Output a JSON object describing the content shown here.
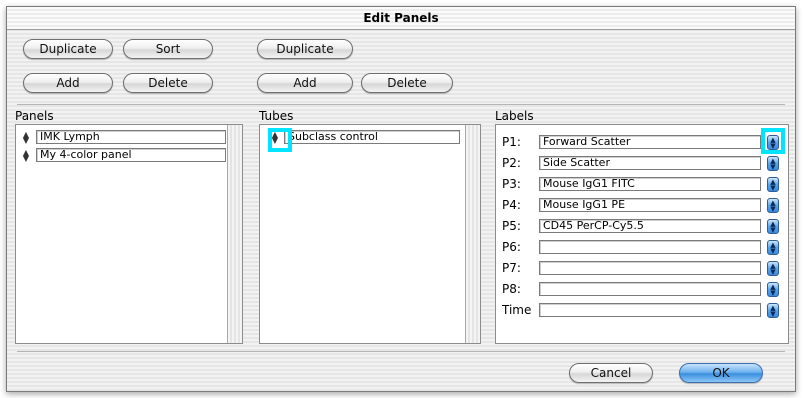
{
  "window": {
    "title": "Edit Panels"
  },
  "panel_buttons": {
    "duplicate": "Duplicate",
    "sort": "Sort",
    "add": "Add",
    "delete": "Delete"
  },
  "tube_buttons": {
    "duplicate": "Duplicate",
    "add": "Add",
    "delete": "Delete"
  },
  "panels": {
    "label": "Panels",
    "items": [
      "IMK Lymph",
      "My 4-color panel"
    ]
  },
  "tubes": {
    "label": "Tubes",
    "items": [
      "Subclass control"
    ]
  },
  "labels": {
    "label": "Labels",
    "rows": [
      {
        "name": "P1:",
        "value": "Forward Scatter"
      },
      {
        "name": "P2:",
        "value": "Side Scatter"
      },
      {
        "name": "P3:",
        "value": "Mouse IgG1 FITC"
      },
      {
        "name": "P4:",
        "value": "Mouse IgG1 PE"
      },
      {
        "name": "P5:",
        "value": "CD45 PerCP-Cy5.5"
      },
      {
        "name": "P6:",
        "value": ""
      },
      {
        "name": "P7:",
        "value": ""
      },
      {
        "name": "P8:",
        "value": ""
      },
      {
        "name": "Time",
        "value": ""
      }
    ]
  },
  "footer": {
    "cancel": "Cancel",
    "ok": "OK"
  },
  "icons": {
    "updown": "updown-arrows-icon",
    "stepper": "stepper-icon"
  },
  "colors": {
    "highlight": "#00e5ff",
    "default_button": "#3b8fe0"
  }
}
